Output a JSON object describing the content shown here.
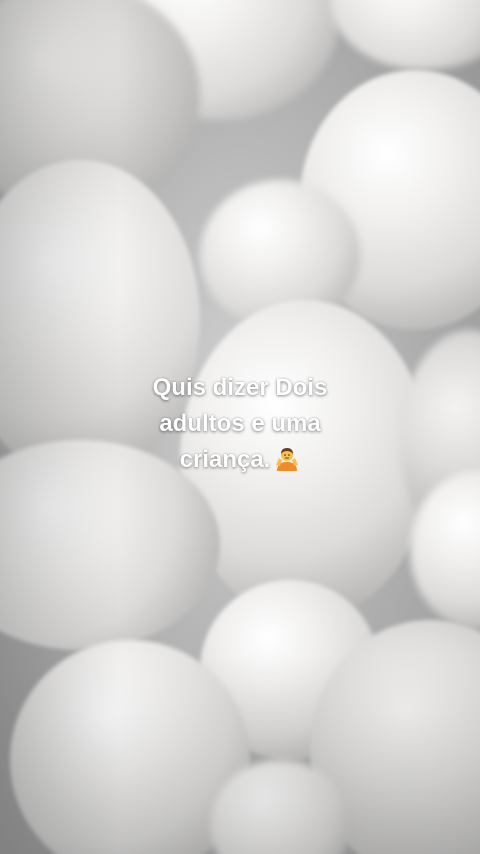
{
  "caption": {
    "line1": "Quis dizer Dois",
    "line2": "adultos e uma",
    "line3": "criança."
  },
  "emoji_icon": "person-shrugging-icon",
  "colors": {
    "text": "#ffffff",
    "emoji_shirt": "#f08a2c",
    "emoji_skin": "#f7c04a"
  }
}
